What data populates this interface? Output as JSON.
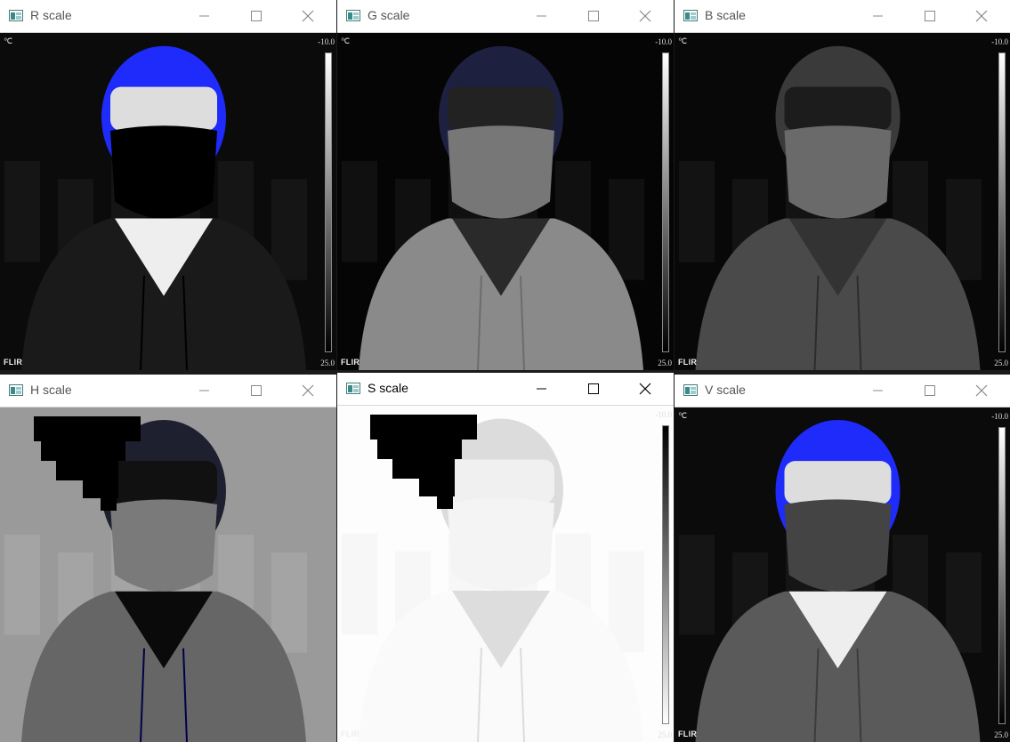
{
  "windows": [
    {
      "id": "r",
      "title": "R scale",
      "unit": "℃",
      "max": "-10.0",
      "min": "25.0",
      "brand": "FLIR",
      "bar": "light-top",
      "face": "#ddd",
      "mask": "#000",
      "body": "#1a1a1a",
      "neck": "#eee",
      "bg": "#0b0b0b"
    },
    {
      "id": "g",
      "title": "G scale",
      "unit": "℃",
      "max": "-10.0",
      "min": "25.0",
      "brand": "FLIR",
      "bar": "light-top",
      "face": "#222",
      "mask": "#777",
      "body": "#8a8a8a",
      "neck": "#2a2a2a",
      "bg": "#050505"
    },
    {
      "id": "b",
      "title": "B scale",
      "unit": "℃",
      "max": "-10.0",
      "min": "25.0",
      "brand": "FLIR",
      "bar": "light-top",
      "face": "#1c1c1c",
      "mask": "#6a6a6a",
      "body": "#4a4a4a",
      "neck": "#333",
      "bg": "#080808"
    },
    {
      "id": "h",
      "title": "H scale",
      "unit": "",
      "max": "",
      "min": "",
      "brand": "",
      "bar": "none",
      "face": "#111",
      "mask": "#7a7a7a",
      "body": "#666",
      "neck": "#0a0a0a",
      "bg": "#9a9a9a"
    },
    {
      "id": "s",
      "title": "S scale",
      "unit": "",
      "max": "-10.0",
      "min": "25.0",
      "brand": "FLIR",
      "bar": "dark-top",
      "face": "#f0f0f0",
      "mask": "#f4f4f4",
      "body": "#fafafa",
      "neck": "#ddd",
      "bg": "#fdfdfd"
    },
    {
      "id": "v",
      "title": "V scale",
      "unit": "℃",
      "max": "-10.0",
      "min": "25.0",
      "brand": "FLIR",
      "bar": "light-top",
      "face": "#ddd",
      "mask": "#444",
      "body": "#5a5a5a",
      "neck": "#eee",
      "bg": "#0b0b0b"
    }
  ],
  "active_window": "S scale",
  "icons": {
    "minimize": "minimize-icon",
    "maximize": "maximize-icon",
    "close": "close-icon",
    "app": "window-app-icon"
  }
}
